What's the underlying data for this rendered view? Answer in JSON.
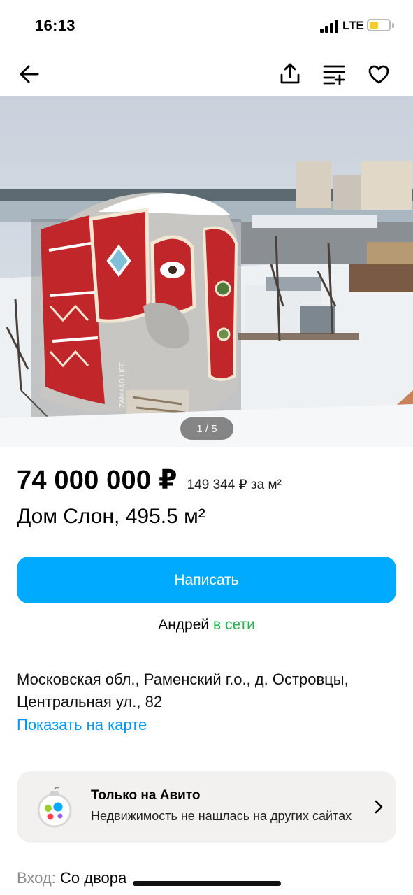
{
  "status_bar": {
    "time": "16:13",
    "network": "LTE",
    "battery_color": "#f3cc2e"
  },
  "nav": {
    "icons": [
      "back-arrow-icon",
      "share-icon",
      "compare-icon",
      "favorite-heart-icon"
    ]
  },
  "gallery": {
    "counter": "1 / 5",
    "watermark": "ZAMKAD LIFE"
  },
  "listing": {
    "price": "74 000 000 ₽",
    "price_per_m2": "149 344 ₽ за м²",
    "title": "Дом Слон, 495.5 м²"
  },
  "contact": {
    "write_button": "Написать",
    "seller_name": "Андрей",
    "seller_status": "в сети"
  },
  "location": {
    "address": "Московская обл., Раменский г.о., д. Островцы, Центральная ул., 82",
    "map_link": "Показать на карте"
  },
  "promo": {
    "title": "Только на Авито",
    "subtitle": "Недвижимость не нашлась на других сайтах",
    "icon": "avito-ornament-icon"
  },
  "details": {
    "entry_label": "Вход:",
    "entry_value": "Со двора"
  },
  "colors": {
    "accent": "#00aaff",
    "link": "#0099f7",
    "online": "#22b04b",
    "promo_bg": "#f2f1f0"
  }
}
